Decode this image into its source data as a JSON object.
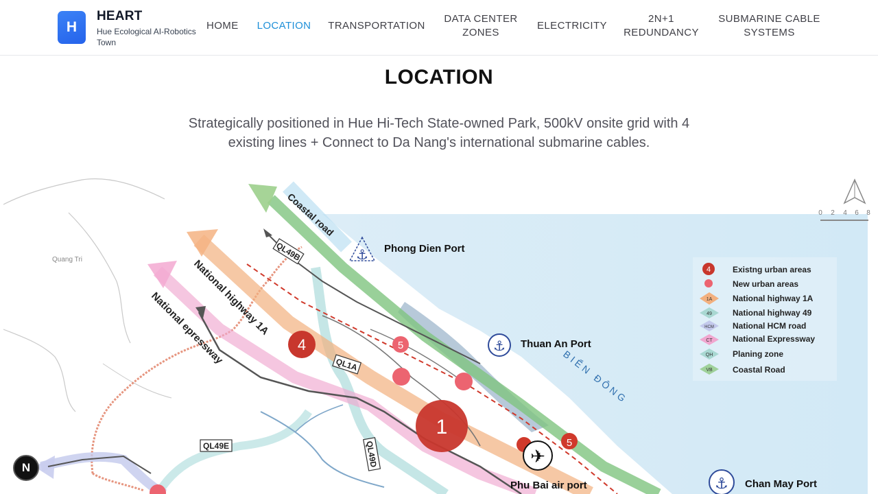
{
  "brand": {
    "logo_letter": "H",
    "name": "HEART",
    "subtitle": "Hue Ecological AI-Robotics Town"
  },
  "nav": [
    {
      "label": "HOME"
    },
    {
      "label": "LOCATION"
    },
    {
      "label": "TRANSPORTATION"
    },
    {
      "label": "DATA CENTER ZONES"
    },
    {
      "label": "ELECTRICITY"
    },
    {
      "label": "2N+1 REDUNDANCY"
    },
    {
      "label": "SUBMARINE CABLE SYSTEMS"
    }
  ],
  "section": {
    "title": "LOCATION",
    "description": "Strategically positioned in Hue Hi-Tech State-owned Park, 500kV onsite grid with 4 existing lines + Connect to Da Nang's international submarine cables."
  },
  "map": {
    "region_label": "Quang Tri",
    "sea_label": "BIỂN ĐÔNG",
    "ports": [
      "Phong Dien Port",
      "Thuan An Port",
      "Chan May Port"
    ],
    "airport": "Phu Bai air port",
    "roads": [
      "Coastal road",
      "QL49B",
      "National highway 1A",
      "National epressway",
      "QL1A",
      "QL49E",
      "QL49D"
    ],
    "urban_numbers": [
      "4",
      "5",
      "1",
      "5"
    ],
    "scale_ticks": [
      "0",
      "2",
      "4",
      "6",
      "8"
    ],
    "legend": [
      {
        "label": "Existng urban areas",
        "symbol": "4"
      },
      {
        "label": "New urban areas",
        "symbol": ""
      },
      {
        "label": "National highway 1A",
        "symbol": "1A"
      },
      {
        "label": "National highway 49",
        "symbol": "49"
      },
      {
        "label": "National HCM road",
        "symbol": "HCM"
      },
      {
        "label": "National Expressway",
        "symbol": "CT"
      },
      {
        "label": "Planing zone",
        "symbol": "QH"
      },
      {
        "label": "Coastal Road",
        "symbol": "VB"
      }
    ]
  },
  "dev_badge": {
    "letter": "N"
  },
  "colors": {
    "accent": "#1d8fd8",
    "sea": "#d6ecf8",
    "urban": "#c8372d",
    "new_urban": "#ec6470"
  }
}
